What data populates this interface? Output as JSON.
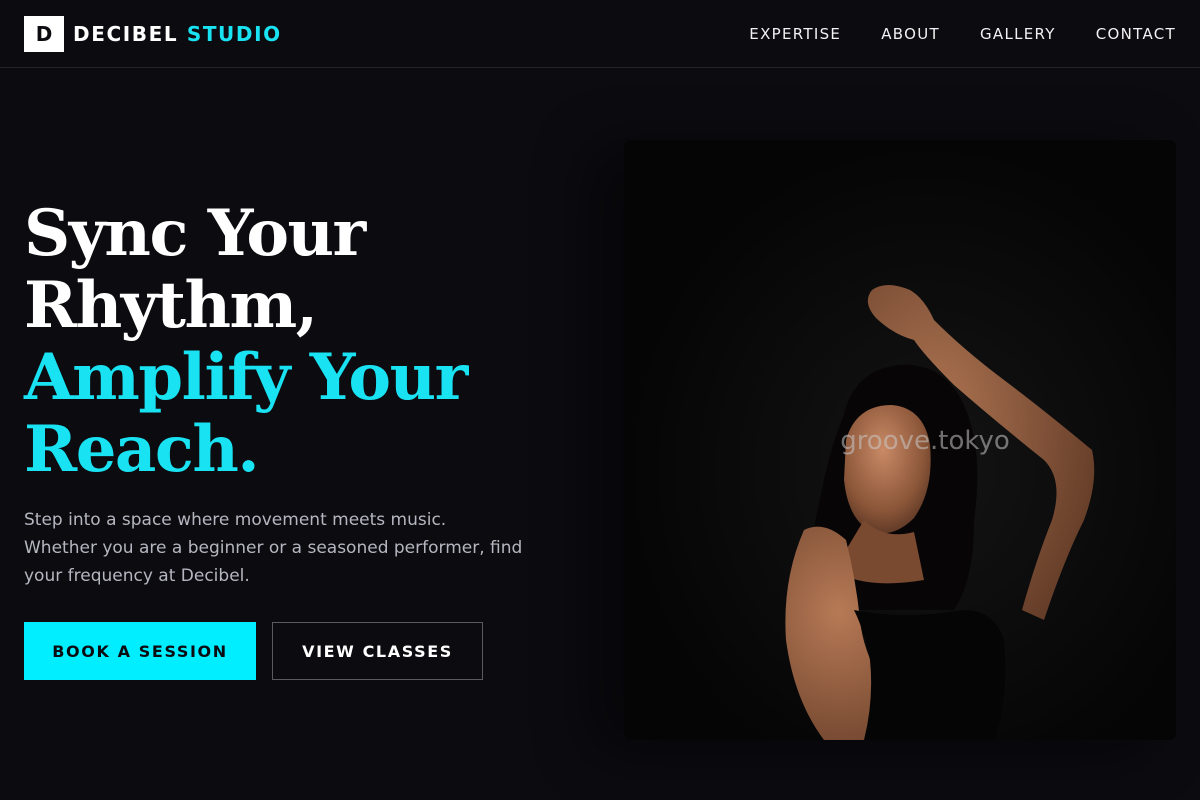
{
  "brand": {
    "mark": "D",
    "name": "DECIBEL",
    "accent_word": "STUDIO"
  },
  "nav": {
    "items": [
      {
        "label": "EXPERTISE"
      },
      {
        "label": "ABOUT"
      },
      {
        "label": "GALLERY"
      },
      {
        "label": "CONTACT"
      }
    ]
  },
  "hero": {
    "headline_lines": [
      "Sync Your",
      "Rhythm,"
    ],
    "headline_accent_lines": [
      "Amplify Your",
      "Reach."
    ],
    "subtext": "Step into a space where movement meets music. Whether you are a beginner or a seasoned performer, find your frequency at Decibel.",
    "primary_cta": "BOOK A SESSION",
    "secondary_cta": "VIEW CLASSES"
  },
  "photo": {
    "watermark": "groove.tokyo"
  },
  "colors": {
    "background": "#0b0b10",
    "accent": "#19e3f2",
    "primary_button": "#00eeff",
    "text": "#ffffff",
    "muted_text": "#b6b6c0"
  }
}
